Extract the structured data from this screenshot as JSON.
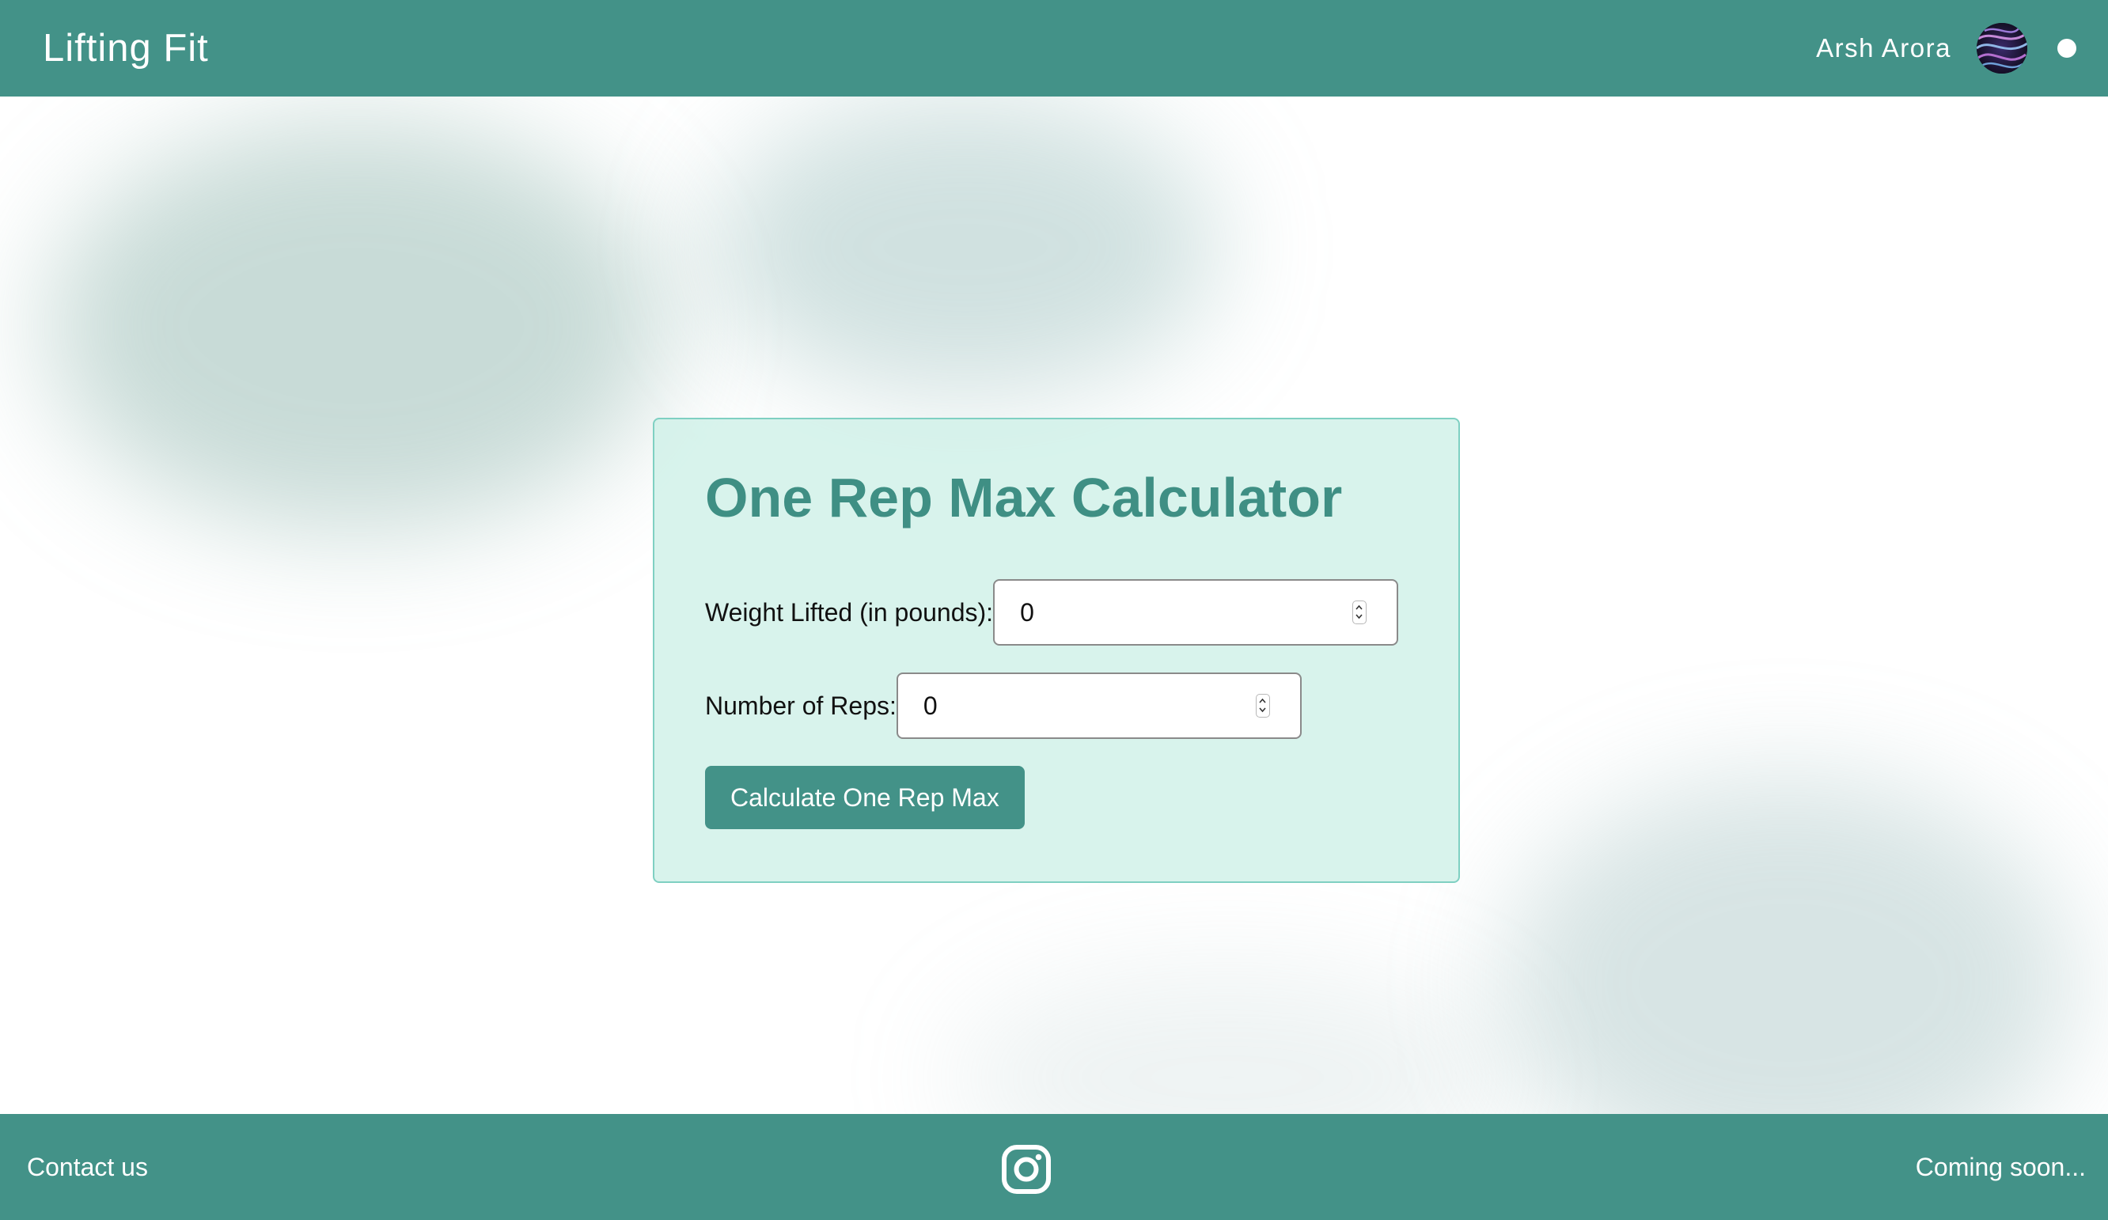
{
  "header": {
    "brand": "Lifting Fit",
    "user_name": "Arsh Arora"
  },
  "calculator": {
    "title": "One Rep Max Calculator",
    "weight_label": "Weight Lifted (in pounds):",
    "weight_value": "0",
    "reps_label": "Number of Reps:",
    "reps_value": "0",
    "button_label": "Calculate One Rep Max"
  },
  "footer": {
    "contact_label": "Contact us",
    "social_icon": "instagram-icon",
    "coming_soon_label": "Coming soon..."
  },
  "colors": {
    "primary": "#439288",
    "title": "#3f8f84",
    "card_background": "#d6f2ec",
    "card_border": "#7fd0c2"
  }
}
